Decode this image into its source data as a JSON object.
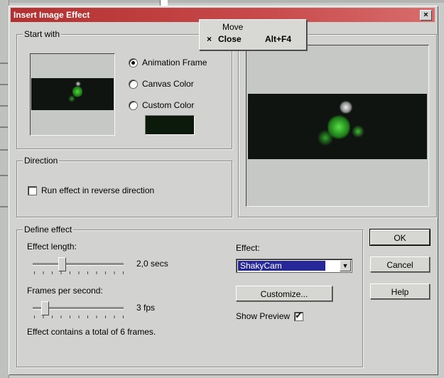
{
  "dialog": {
    "title": "Insert Image Effect",
    "close_glyph": "×"
  },
  "context_menu": {
    "move_label": "Move",
    "close_glyph": "×",
    "close_label": "Close",
    "close_shortcut": "Alt+F4"
  },
  "start_with": {
    "legend": "Start with",
    "options": [
      {
        "label": "Animation Frame",
        "selected": true
      },
      {
        "label": "Canvas Color",
        "selected": false
      },
      {
        "label": "Custom Color",
        "selected": false
      }
    ],
    "custom_color": "#0b1a0b"
  },
  "direction": {
    "legend": "Direction",
    "reverse_label": "Run effect in reverse direction",
    "reverse_checked": false
  },
  "define_effect": {
    "legend": "Define effect",
    "effect_length_label": "Effect length:",
    "effect_length_value": "2,0 secs",
    "fps_label": "Frames per second:",
    "fps_value": "3 fps",
    "summary": "Effect contains a total of 6 frames.",
    "effect_label": "Effect:",
    "effect_selected": "ShakyCam",
    "customize_label": "Customize...",
    "show_preview_label": "Show Preview",
    "show_preview_checked": true
  },
  "buttons": {
    "ok": "OK",
    "cancel": "Cancel",
    "help": "Help"
  },
  "colors": {
    "title_bar": "#b33030",
    "selection": "#26289a",
    "dialog_bg": "#d2d3d0"
  }
}
